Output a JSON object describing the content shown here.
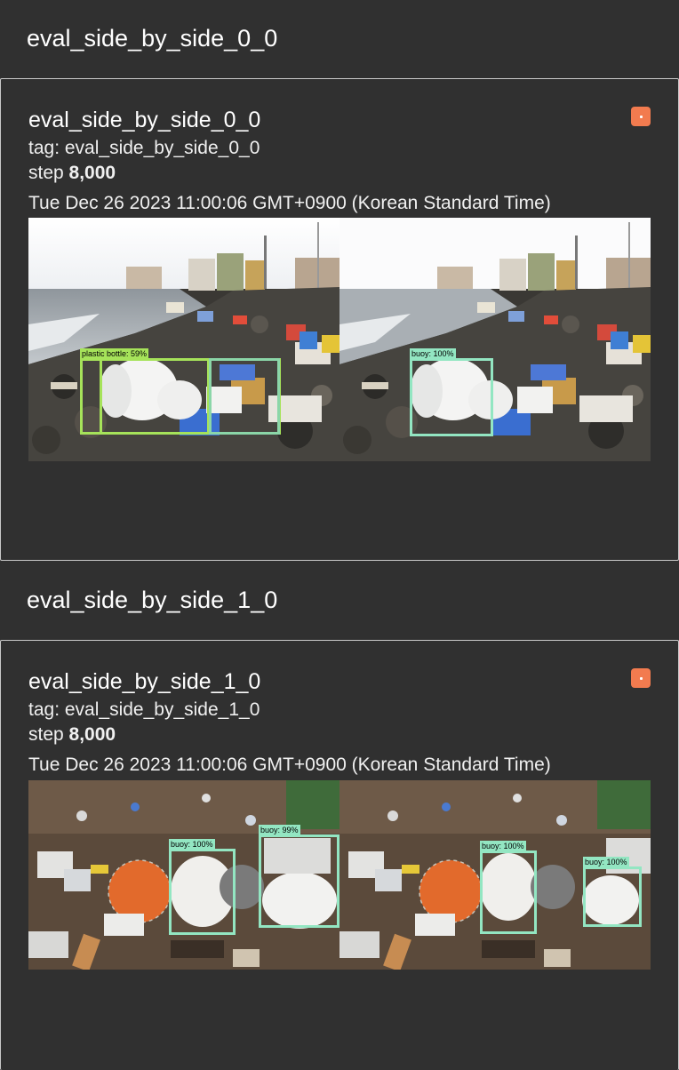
{
  "sections": [
    {
      "header": "eval_side_by_side_0_0",
      "card": {
        "title": "eval_side_by_side_0_0",
        "tag": "tag: eval_side_by_side_0_0",
        "step_label": "step",
        "step_value": "8,000",
        "timestamp": "Tue Dec 26 2023 11:00:06 GMT+0900 (Korean Standard Time)",
        "left_detections": [
          {
            "label": "plastic bottle: 59%"
          }
        ],
        "right_detections": [
          {
            "label": "buoy: 100%"
          }
        ]
      }
    },
    {
      "header": "eval_side_by_side_1_0",
      "card": {
        "title": "eval_side_by_side_1_0",
        "tag": "tag: eval_side_by_side_1_0",
        "step_label": "step",
        "step_value": "8,000",
        "timestamp": "Tue Dec 26 2023 11:00:06 GMT+0900 (Korean Standard Time)",
        "left_detections": [
          {
            "label": "buoy: 100%"
          },
          {
            "label": "buoy: 99%"
          }
        ],
        "right_detections": [
          {
            "label": "buoy: 100%"
          },
          {
            "label": "buoy: 100%"
          }
        ]
      }
    }
  ],
  "colors": {
    "background": "#303030",
    "border": "#c9c9c9",
    "pin_button": "#f27b4f",
    "box_green": "#a6e35a",
    "box_teal": "#93e6c2"
  },
  "icons": {
    "pin": "pin-icon"
  }
}
